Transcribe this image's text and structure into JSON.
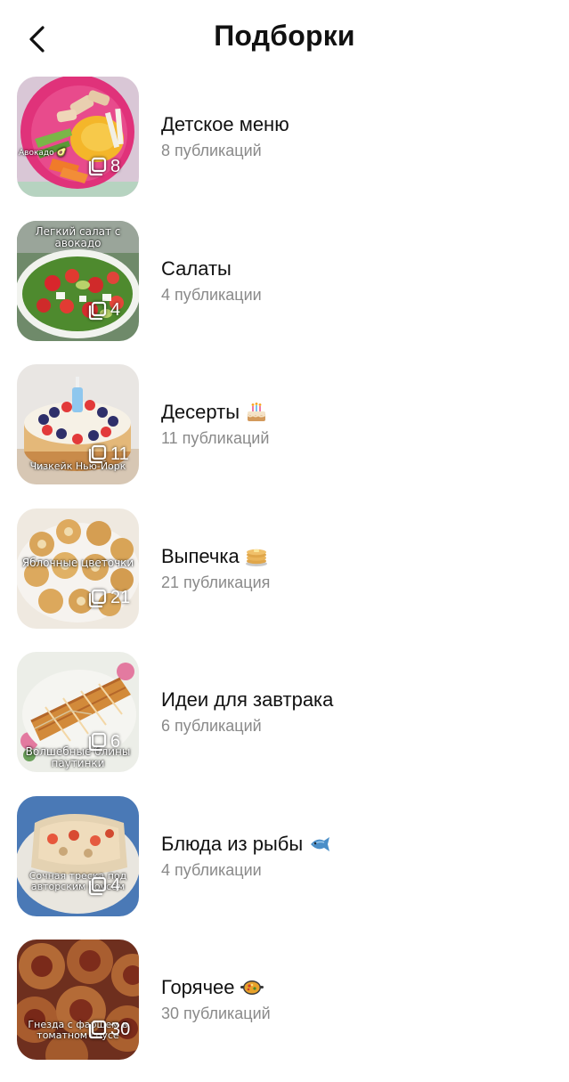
{
  "header": {
    "title": "Подборки",
    "back_icon": "chevron-left-icon"
  },
  "collections": [
    {
      "title": "Детское меню",
      "count_label": "8 публикаций",
      "thumb_count": "8",
      "caption": "Авокадо 🥑",
      "emoji": ""
    },
    {
      "title": "Салаты",
      "count_label": "4 публикации",
      "thumb_count": "4",
      "caption": "Легкий салат с авокадо",
      "emoji": ""
    },
    {
      "title": "Десерты",
      "count_label": "11 публикаций",
      "thumb_count": "11",
      "caption": "Чизкейк Нью-Йорк",
      "emoji": "birthday-cake-icon"
    },
    {
      "title": "Выпечка",
      "count_label": "21 публикация",
      "thumb_count": "21",
      "caption": "Яблочные цветочки",
      "emoji": "pancakes-icon"
    },
    {
      "title": "Идеи для завтрака",
      "count_label": "6 публикаций",
      "thumb_count": "6",
      "caption": "Волшебные блины паутинки",
      "emoji": ""
    },
    {
      "title": "Блюда из рыбы",
      "count_label": "4 публикации",
      "thumb_count": "4",
      "caption": "Сочная треска под авторским соусом",
      "emoji": "fish-icon"
    },
    {
      "title": "Горячее",
      "count_label": "30 публикаций",
      "thumb_count": "30",
      "caption": "Гнезда с фаршем в томатном соусе",
      "emoji": "paella-pan-icon"
    }
  ]
}
